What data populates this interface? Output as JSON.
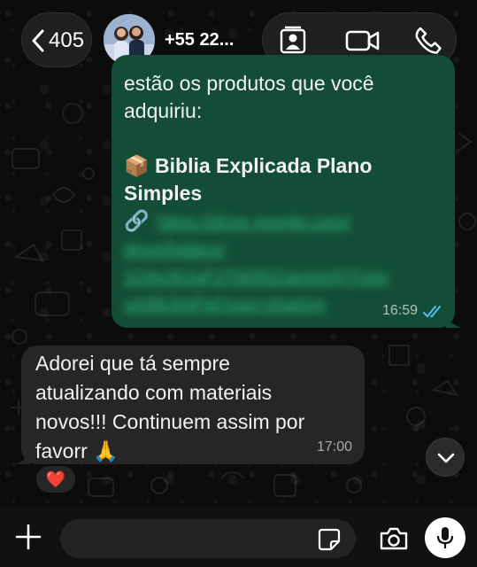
{
  "header": {
    "back_count": "405",
    "contact_name": "+55 22...",
    "icons": [
      "chevron-left-icon",
      "contact-card-icon",
      "video-call-icon",
      "phone-icon"
    ]
  },
  "outgoing_message": {
    "lines": [
      "estão os produtos que você",
      "adquiriu:"
    ],
    "product_emoji": "📦",
    "product_title_line1": "Biblia Explicada Plano",
    "product_title_line2": "Simples",
    "link_emoji": "🔗",
    "link_lines": [
      "https://drive.google.com/",
      "drive/folders/",
      "1OAcWJuF3TM3NZoe4oHQTmIv",
      "xA9Ik3mPaQusp=sharing"
    ],
    "time": "16:59",
    "status": "read"
  },
  "incoming_message": {
    "lines": [
      "Adorei que tá sempre",
      "atualizando com materiais",
      "novos!!! Continuem assim por",
      "favorr 🙏"
    ],
    "time": "17:00"
  },
  "reaction": "❤️",
  "composer": {
    "placeholder": ""
  },
  "colors": {
    "outgoing_bubble": "#134d37",
    "incoming_bubble": "#262626",
    "read_ticks": "#53bdeb",
    "link": "#2fb57a"
  }
}
